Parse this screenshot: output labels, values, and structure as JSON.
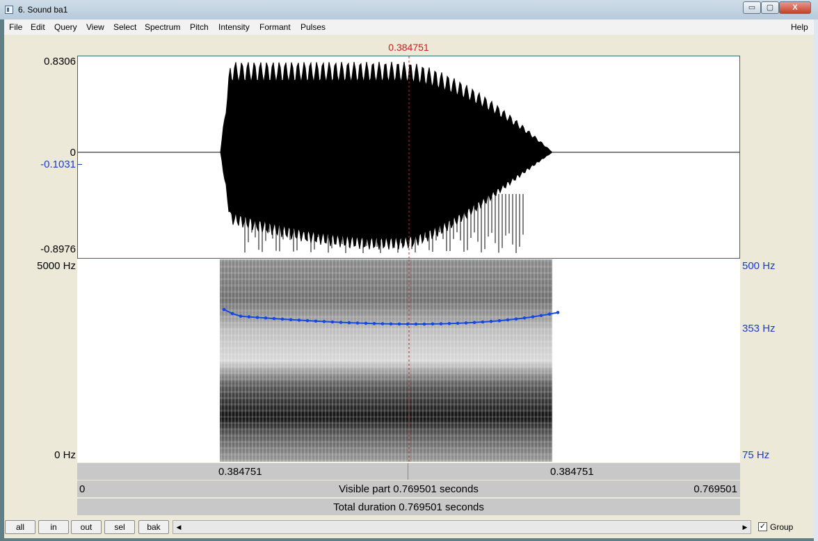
{
  "window": {
    "title": "6. Sound ba1",
    "minimize_glyph": "▭",
    "maximize_glyph": "▢",
    "close_glyph": "X"
  },
  "menu": {
    "items": [
      "File",
      "Edit",
      "Query",
      "View",
      "Select",
      "Spectrum",
      "Pitch",
      "Intensity",
      "Formant",
      "Pulses"
    ],
    "help": "Help"
  },
  "editor": {
    "cursor_time": "0.384751",
    "waveform": {
      "y_max": "0.8306",
      "y_zero": "0",
      "y_cursor_value": "-0.1031",
      "y_min": "-0.8976"
    },
    "spectrogram": {
      "freq_top": "5000 Hz",
      "freq_bottom": "0 Hz"
    },
    "pitch": {
      "top": "500 Hz",
      "cursor_value": "353 Hz",
      "bottom": "75 Hz",
      "contour_color": "#1448e0"
    },
    "cursor_color": "#c8201e",
    "time_bars": {
      "left_part": "0.384751",
      "right_part": "0.384751",
      "visible_start": "0",
      "visible_text": "Visible part 0.769501 seconds",
      "visible_end": "0.769501",
      "total_text": "Total duration 0.769501 seconds"
    }
  },
  "toolbar": {
    "buttons": [
      "all",
      "in",
      "out",
      "sel",
      "bak"
    ],
    "scroll_left_glyph": "◀",
    "scroll_right_glyph": "▶",
    "group_label": "Group",
    "group_checked": "✓"
  }
}
